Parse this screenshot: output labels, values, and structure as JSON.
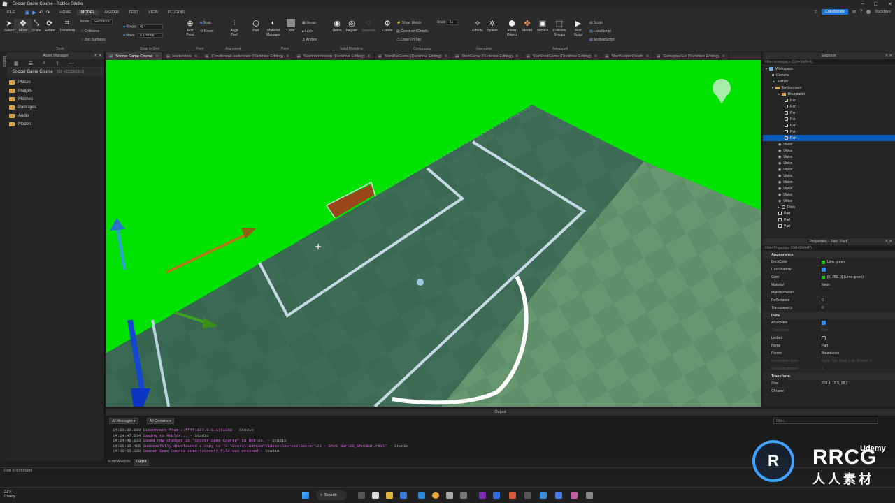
{
  "window": {
    "title": "Soccer Game Course - Roblox Studio",
    "user": "Duckhive"
  },
  "menu": {
    "file": "FILE",
    "tabs": [
      "HOME",
      "MODEL",
      "AVATAR",
      "TEST",
      "VIEW",
      "PLUGINS"
    ],
    "active": "MODEL",
    "collaborate": "Collaborate"
  },
  "ribbon": {
    "tools": [
      "Select",
      "Move",
      "Scale",
      "Rotate",
      "Transform"
    ],
    "tools_group": "Tools",
    "mode_label": "Mode:",
    "mode_value": "Geometric",
    "collisions": "Collisions",
    "join_surfaces": "Join Surfaces",
    "rotate_label": "Rotate",
    "rotate_value": "45 °",
    "move_label": "Move",
    "move_value": "0.1 studs",
    "snap_group": "Snap to Grid",
    "edit_pivot": "Edit Pivot",
    "snap": "Snap",
    "reset": "Reset",
    "pivot_group": "Pivot",
    "align_tool": "Align Tool",
    "alignment_group": "Alignment",
    "part": "Part",
    "material_manager": "Material Manager",
    "color": "Color",
    "group": "Group",
    "lock": "Lock",
    "anchor": "Anchor",
    "parts_group": "Parts",
    "union": "Union",
    "negate": "Negate",
    "separate": "Separate",
    "solid_group": "Solid Modeling",
    "create": "Create",
    "show_welds": "Show Welds",
    "constraint_details": "Constraint Details",
    "draw_on_top": "Draw On Top",
    "scale_label": "Scale",
    "scale_value": "1x",
    "constraints_group": "Constraints",
    "effects": "Effects",
    "spawn": "Spawn",
    "gameplay_group": "Gameplay",
    "insert_object": "Insert Object",
    "model": "Model",
    "service": "Service",
    "collision_groups": "Collision Groups",
    "run_script": "Run Script",
    "script": "Script",
    "local_script": "LocalScript",
    "module_script": "ModuleScript",
    "advanced_group": "Advanced"
  },
  "asset_manager": {
    "title": "Asset Manager",
    "sidebar_tab": "Toolbox",
    "game_name": "Soccer Game Course",
    "game_id": "[ID: 4222956361]",
    "items": [
      "Places",
      "Images",
      "Meshes",
      "Packages",
      "Audio",
      "Models"
    ]
  },
  "tabs": [
    {
      "label": "Soccer Game Course",
      "active": true
    },
    {
      "label": "leaderstats",
      "active": false
    },
    {
      "label": "ConditionalLeaderstats (Duckhive Editing)",
      "active": false
    },
    {
      "label": "StartIntermission (Duckhive Editing)",
      "active": false
    },
    {
      "label": "StartPreGame (Duckhive Editing)",
      "active": false
    },
    {
      "label": "StartGame (Duckhive Editing)",
      "active": false
    },
    {
      "label": "StartPostGame (Duckhive Editing)",
      "active": false
    },
    {
      "label": "StartSuddenDeath",
      "active": false
    },
    {
      "label": "GameplayGui (Duckhive Editing)",
      "active": false
    }
  ],
  "explorer": {
    "title": "Explorer",
    "filter": "Filter workspace (Ctrl+Shift+X)",
    "rows": [
      {
        "label": "Workspace",
        "depth": 0,
        "icon": "workspace"
      },
      {
        "label": "Camera",
        "depth": 1,
        "icon": "camera"
      },
      {
        "label": "Terrain",
        "depth": 1,
        "icon": "terrain"
      },
      {
        "label": "Environment",
        "depth": 1,
        "icon": "folder"
      },
      {
        "label": "Boundaries",
        "depth": 2,
        "icon": "folder"
      },
      {
        "label": "Part",
        "depth": 3,
        "icon": "part"
      },
      {
        "label": "Part",
        "depth": 3,
        "icon": "part"
      },
      {
        "label": "Part",
        "depth": 3,
        "icon": "part"
      },
      {
        "label": "Part",
        "depth": 3,
        "icon": "part"
      },
      {
        "label": "Part",
        "depth": 3,
        "icon": "part"
      },
      {
        "label": "Part",
        "depth": 3,
        "icon": "part"
      },
      {
        "label": "Part",
        "depth": 3,
        "icon": "part",
        "selected": true
      },
      {
        "label": "Union",
        "depth": 2,
        "icon": "union"
      },
      {
        "label": "Union",
        "depth": 2,
        "icon": "union"
      },
      {
        "label": "Union",
        "depth": 2,
        "icon": "union"
      },
      {
        "label": "Union",
        "depth": 2,
        "icon": "union"
      },
      {
        "label": "Union",
        "depth": 2,
        "icon": "union"
      },
      {
        "label": "Union",
        "depth": 2,
        "icon": "union"
      },
      {
        "label": "Union",
        "depth": 2,
        "icon": "union"
      },
      {
        "label": "Union",
        "depth": 2,
        "icon": "union"
      },
      {
        "label": "Union",
        "depth": 2,
        "icon": "union"
      },
      {
        "label": "Union",
        "depth": 2,
        "icon": "union"
      },
      {
        "label": "Pitch",
        "depth": 2,
        "icon": "part"
      },
      {
        "label": "Part",
        "depth": 2,
        "icon": "part"
      },
      {
        "label": "Part",
        "depth": 2,
        "icon": "part"
      },
      {
        "label": "Part",
        "depth": 2,
        "icon": "part"
      }
    ]
  },
  "properties": {
    "title": "Properties - Part \"Part\"",
    "filter": "Filter Properties (Ctrl+Shift+P)",
    "appearance": "Appearance",
    "brickcolor": {
      "name": "BrickColor",
      "value": "Lime green"
    },
    "castshadow": "CastShadow",
    "color": {
      "name": "Color",
      "value": "[0, 255, 0] (Lime green)"
    },
    "material": {
      "name": "Material",
      "value": "Neon"
    },
    "materialvariant": "MaterialVariant",
    "reflectance": {
      "name": "Reflectance",
      "value": "0"
    },
    "transparency": {
      "name": "Transparency",
      "value": "0"
    },
    "data": "Data",
    "archivable": "Archivable",
    "classname": {
      "name": "ClassName",
      "value": "Part"
    },
    "locked": "Locked",
    "name": {
      "name": "Name",
      "value": "Part"
    },
    "parent": {
      "name": "Parent",
      "value": "Boundaries"
    },
    "resizeable": {
      "name": "ResizeableFaces",
      "value": "Right, Top, Back, Left, Bottom, F..."
    },
    "resizeinc": {
      "name": "ResizeIncrement",
      "value": "1"
    },
    "transform": "Transform",
    "size": {
      "name": "Size",
      "value": "209.4, 18.5, 28.2"
    },
    "cframe": "CFrame",
    "brick_color_hex": "#00d800"
  },
  "output": {
    "title": "Output",
    "filter_messages": "All Messages",
    "filter_contexts": "All Contexts",
    "filter_placeholder": "Filter...",
    "lines": [
      {
        "time": "14:23:38.989",
        "msg": "Disconnect from ::ffff:127.0.0.1|61288",
        "src": "- Studio"
      },
      {
        "time": "14:24:47.634",
        "msg": "Saving to Roblox...",
        "src": "- Studio"
      },
      {
        "time": "14:24:48.033",
        "msg": "Saved new changes in \"Soccer Game Course\" to Roblox.",
        "src": "- Studio"
      },
      {
        "time": "14:25:05.485",
        "msg": "Successfully downloaded a copy to 'C:\\Users\\leahcim\\Videos\\Courses\\Soccer\\23 - Shot Bar\\23_ShotBar.rbxl'",
        "src": "- Studio"
      },
      {
        "time": "14:30:55.108",
        "msg": "Soccer Game Course auto-recovery file was created",
        "src": "- Studio"
      }
    ],
    "bottom_tabs": [
      "Script Analysis",
      "Output"
    ]
  },
  "command": {
    "placeholder": "Run a command"
  },
  "taskbar": {
    "weather_temp": "31°F",
    "weather_desc": "Cloudy",
    "search": "Search"
  },
  "watermark": {
    "brand": "RRCG",
    "sub": "人人素材",
    "udemy": "Udemy"
  }
}
